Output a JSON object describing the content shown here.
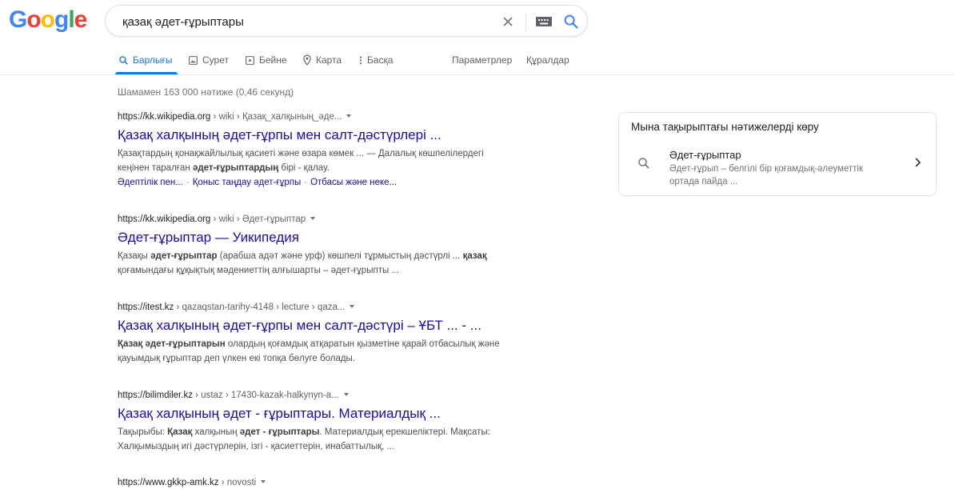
{
  "logo": {
    "letters": [
      "G",
      "o",
      "o",
      "g",
      "l",
      "e"
    ],
    "colors": [
      "#4285f4",
      "#ea4335",
      "#fbbc05",
      "#4285f4",
      "#34a853",
      "#ea4335"
    ]
  },
  "search": {
    "query": "қазақ әдет-ғұрыптары",
    "icons": [
      "close-icon",
      "keyboard-icon",
      "search-icon"
    ]
  },
  "tabs": [
    {
      "label": "Барлығы",
      "icon": "search-icon",
      "active": true
    },
    {
      "label": "Сурет",
      "icon": "image-icon"
    },
    {
      "label": "Бейне",
      "icon": "video-icon"
    },
    {
      "label": "Карта",
      "icon": "map-pin-icon"
    },
    {
      "label": "Басқа",
      "icon": "more-vert-icon"
    },
    {
      "label": "Параметрлер"
    },
    {
      "label": "Құралдар"
    }
  ],
  "stats": "Шамамен 163 000 нәтиже (0,46 секунд)",
  "results": [
    {
      "domain": "https://kk.wikipedia.org",
      "path": " › wiki › Қазақ_халқының_әде...",
      "title": "Қазақ халқының әдет-ғұрпы мен салт-дәстүрлері ...",
      "snippet": [
        [
          {
            "t": "Қазақтардың қонақжайлылық қасиеті және өзара көмек ... — Далалық көшпелілердегі"
          }
        ],
        [
          {
            "t": "кеңінен таралған "
          },
          {
            "t": "әдет-ғұрыптардың",
            "b": true
          },
          {
            "t": " бірі - қалау."
          }
        ]
      ],
      "sitelinks": [
        "Әдептілік пен...",
        "Қоныс таңдау әдет-ғұрпы",
        "Отбасы және неке..."
      ]
    },
    {
      "domain": "https://kk.wikipedia.org",
      "path": " › wiki › Әдет-ғұрыптар",
      "title": "Әдет-ғұрыптар — Уикипедия",
      "snippet": [
        [
          {
            "t": "Қазақы "
          },
          {
            "t": "әдет-ғұрыптар",
            "b": true
          },
          {
            "t": " (арабша адәт және урф) көшпелі тұрмыстың дәстүрлі ... "
          },
          {
            "t": "қазақ",
            "b": true
          }
        ],
        [
          {
            "t": "қоғамындағы құқықтық мәдениеттің алғышарты – әдет-ғұрыпты ..."
          }
        ]
      ]
    },
    {
      "domain": "https://itest.kz",
      "path": " › qazaqstan-tarihy-4148 › lecture › qaza...",
      "title": "Қазақ халқының әдет-ғұрпы мен салт-дәстүрі – ҰБТ ... - ...",
      "snippet": [
        [
          {
            "t": "Қазақ әдет-ғұрыптарын",
            "b": true
          },
          {
            "t": " олардың қоғамдық атқаратын қызметіне қарай отбасылық және"
          }
        ],
        [
          {
            "t": "қауымдық ғұрыптар деп үлкен екі топқа бөлуге болады."
          }
        ]
      ]
    },
    {
      "domain": "https://bilimdiler.kz",
      "path": " › ustaz › 17430-kazak-halkynyn-a...",
      "title": "Қазақ халқының әдет - ғұрыптары. Материалдық ...",
      "snippet": [
        [
          {
            "t": "Тақырыбы: "
          },
          {
            "t": "Қазақ",
            "b": true
          },
          {
            "t": " халқының "
          },
          {
            "t": "әдет - ғұрыптары",
            "b": true
          },
          {
            "t": ". Материалдық ерекшеліктері. Мақсаты:"
          }
        ],
        [
          {
            "t": "Халқымыздың игі дәстүрлерін, ізгі - қасиеттерін, инабаттылық, ..."
          }
        ]
      ]
    },
    {
      "domain": "https://www.gkkp-amk.kz",
      "path": " › novosti",
      "partial": true
    }
  ],
  "side_panel": {
    "title": "Мына тақырыптағы нәтижелерді көру",
    "item_title": "Әдет-ғұрыптар",
    "item_desc": "Әдет-ғұрып – белгілі бір қоғамдық-әлеуметтік ортада пайда ..."
  }
}
